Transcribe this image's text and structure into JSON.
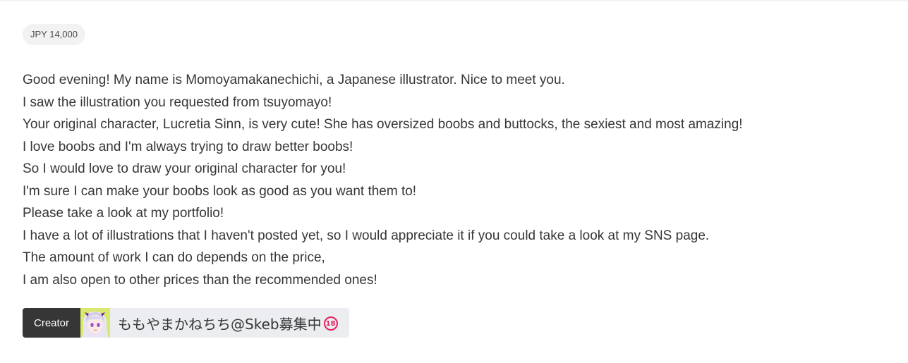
{
  "price": "JPY 14,000",
  "message_lines": [
    "Good evening! My name is Momoyamakanechichi, a Japanese illustrator. Nice to meet you.",
    "I saw the illustration you requested from tsuyomayo!",
    "Your original character, Lucretia Sinn, is very cute! She has oversized boobs and buttocks, the sexiest and most amazing!",
    "I love boobs and I'm always trying to draw better boobs!",
    "So I would love to draw your original character for you!",
    "I'm sure I can make your boobs look as good as you want them to!",
    "Please take a look at my portfolio!",
    "I have a lot of illustrations that I haven't posted yet, so I would appreciate it if you could take a look at my SNS page.",
    "The amount of work I can do depends on the price,",
    "I am also open to other prices than the recommended ones!"
  ],
  "creator": {
    "label": "Creator",
    "name": "ももやまかねちち@Skeb募集中",
    "badge": "18",
    "avatar_icon": "anime-avatar-icon",
    "badge_icon": "no-under-18-icon"
  },
  "colors": {
    "creator_label_bg": "#363636",
    "creator_body_bg": "#ebedf0",
    "price_bg": "#f2f2f2",
    "badge": "#e0245e"
  }
}
